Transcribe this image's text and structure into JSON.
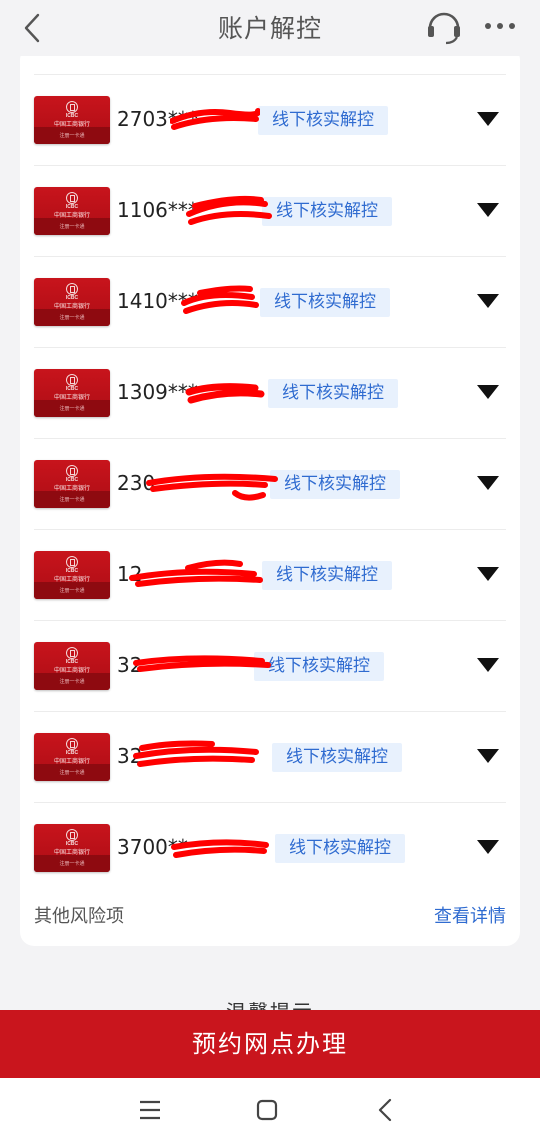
{
  "header": {
    "title": "账户解控",
    "back_icon": "chevron-left-icon",
    "service_icon": "headset-icon",
    "more_icon": "more-dots-icon"
  },
  "accounts": [
    {
      "number": "2703***",
      "tag": "线下核实解控"
    },
    {
      "number": "1106****",
      "tag": "线下核实解控"
    },
    {
      "number": "1410***",
      "tag": "线下核实解控"
    },
    {
      "number": "1309***",
      "tag": "线下核实解控"
    },
    {
      "number": "230",
      "tag": "线下核实解控"
    },
    {
      "number": "12",
      "tag": "线下核实解控"
    },
    {
      "number": "32",
      "tag": "线下核实解控"
    },
    {
      "number": "32",
      "tag": "线下核实解控"
    },
    {
      "number": "3700**",
      "tag": "线下核实解控"
    }
  ],
  "other_risk": {
    "label": "其他风险项",
    "link": "查看详情"
  },
  "tips_title": "温馨提示",
  "primary_button": "预约网点办理",
  "colors": {
    "accent_red": "#c9151d",
    "link_blue": "#2f6bd0",
    "tag_bg": "#e8f1fd"
  }
}
